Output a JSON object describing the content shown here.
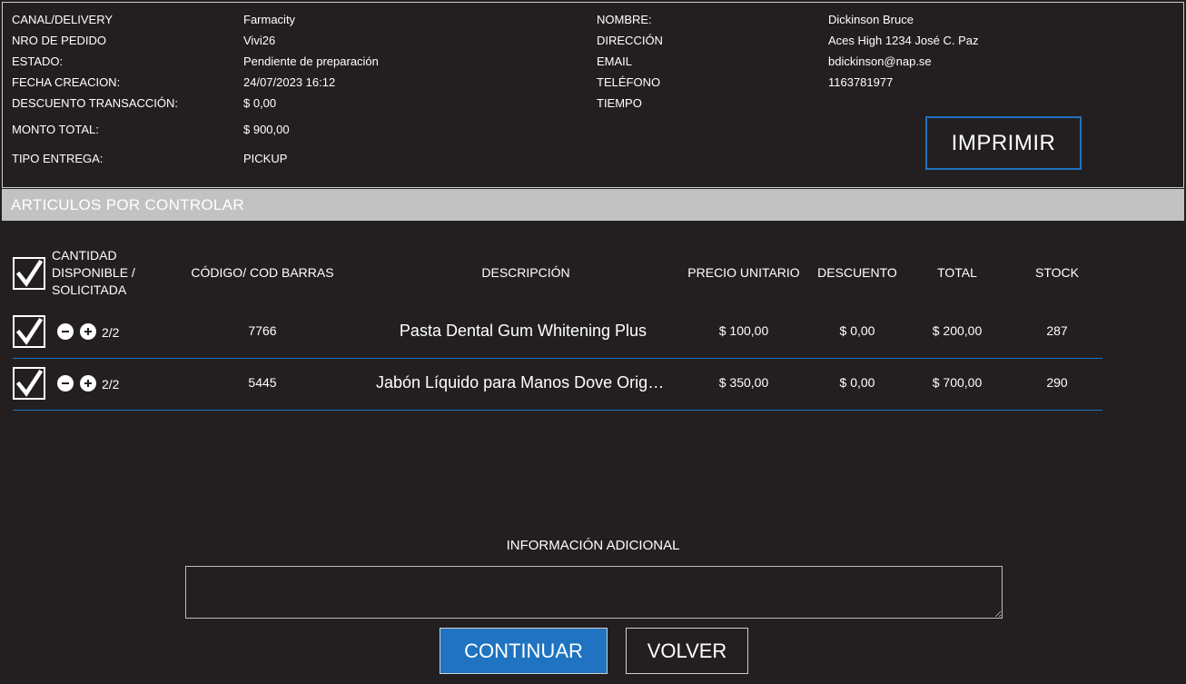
{
  "order_info": {
    "canal_label": "CANAL/DELIVERY",
    "canal_value": "Farmacity",
    "nro_label": "NRO DE PEDIDO",
    "nro_value": "Vivi26",
    "estado_label": "ESTADO:",
    "estado_value": "Pendiente de preparación",
    "fecha_label": "FECHA CREACION:",
    "fecha_value": "24/07/2023 16:12",
    "descuento_label": "DESCUENTO TRANSACCIÓN:",
    "descuento_value": "$ 0,00",
    "monto_label": "MONTO TOTAL:",
    "monto_value": "$ 900,00",
    "tipo_label": "TIPO ENTREGA:",
    "tipo_value": "PICKUP"
  },
  "customer_info": {
    "nombre_label": "NOMBRE:",
    "nombre_value": "Dickinson Bruce",
    "direccion_label": "DIRECCIÓN",
    "direccion_value": "Aces High 1234 José C. Paz",
    "email_label": "EMAIL",
    "email_value": "bdickinson@nap.se",
    "telefono_label": "TELÉFONO",
    "telefono_value": "1163781977",
    "tiempo_label": "TIEMPO"
  },
  "print_button": "IMPRIMIR",
  "section_title": "ARTICULOS POR CONTROLAR",
  "table": {
    "headers": {
      "cantidad_1": "CANTIDAD",
      "cantidad_2": "DISPONIBLE /",
      "cantidad_3": "SOLICITADA",
      "codigo": "CÓDIGO/ COD BARRAS",
      "descripcion": "DESCRIPCIÓN",
      "precio": "PRECIO UNITARIO",
      "descuento": "DESCUENTO",
      "total": "TOTAL",
      "stock": "STOCK"
    },
    "rows": [
      {
        "qty": "2/2",
        "codigo": "7766",
        "descripcion": "Pasta Dental Gum Whitening Plus",
        "precio": "$ 100,00",
        "descuento": "$ 0,00",
        "total": "$ 200,00",
        "stock": "287",
        "checked": true
      },
      {
        "qty": "2/2",
        "codigo": "5445",
        "descripcion": "Jabón Líquido para Manos Dove Original",
        "precio": "$ 350,00",
        "descuento": "$ 0,00",
        "total": "$ 700,00",
        "stock": "290",
        "checked": true
      }
    ]
  },
  "additional_info_label": "INFORMACIÓN ADICIONAL",
  "additional_info_value": "",
  "continue_button": "CONTINUAR",
  "back_button": "VOLVER",
  "colors": {
    "background": "#231f20",
    "accent": "#1f73c0",
    "section_bar": "#c2c2c2"
  }
}
